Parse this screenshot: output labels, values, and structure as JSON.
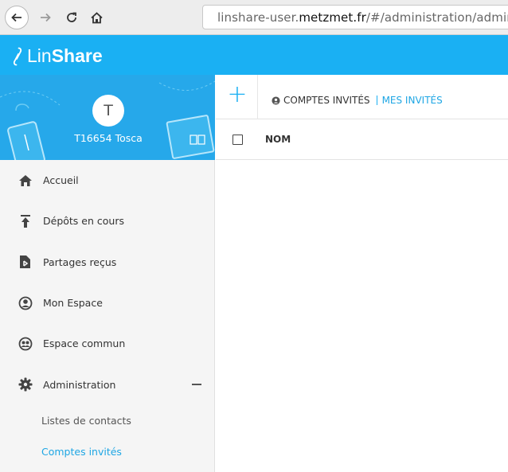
{
  "browser": {
    "url_prefix": "linshare-user.",
    "url_domain": "metzmet.fr",
    "url_path": "/#/administration/adminguests"
  },
  "header": {
    "logo_light": "Lin",
    "logo_bold": "Share"
  },
  "profile": {
    "initial": "T",
    "name": "T16654 Tosca"
  },
  "sidebar": {
    "items": [
      {
        "label": "Accueil",
        "icon": "home-icon"
      },
      {
        "label": "Dépôts en cours",
        "icon": "upload-icon"
      },
      {
        "label": "Partages reçus",
        "icon": "received-shares-icon"
      },
      {
        "label": "Mon Espace",
        "icon": "user-circle-icon"
      },
      {
        "label": "Espace commun",
        "icon": "group-icon"
      },
      {
        "label": "Administration",
        "icon": "gear-icon"
      }
    ],
    "subitems": [
      {
        "label": "Listes de contacts"
      },
      {
        "label": "Comptes invités"
      }
    ]
  },
  "toolbar": {
    "add_label": "+",
    "crumb_guest_accounts": "COMPTES INVITÉS",
    "crumb_my_guests": "MES INVITÉS"
  },
  "table": {
    "columns": [
      "NOM"
    ]
  },
  "colors": {
    "brand": "#1ab0f3",
    "active_link": "#1ea6e4"
  }
}
